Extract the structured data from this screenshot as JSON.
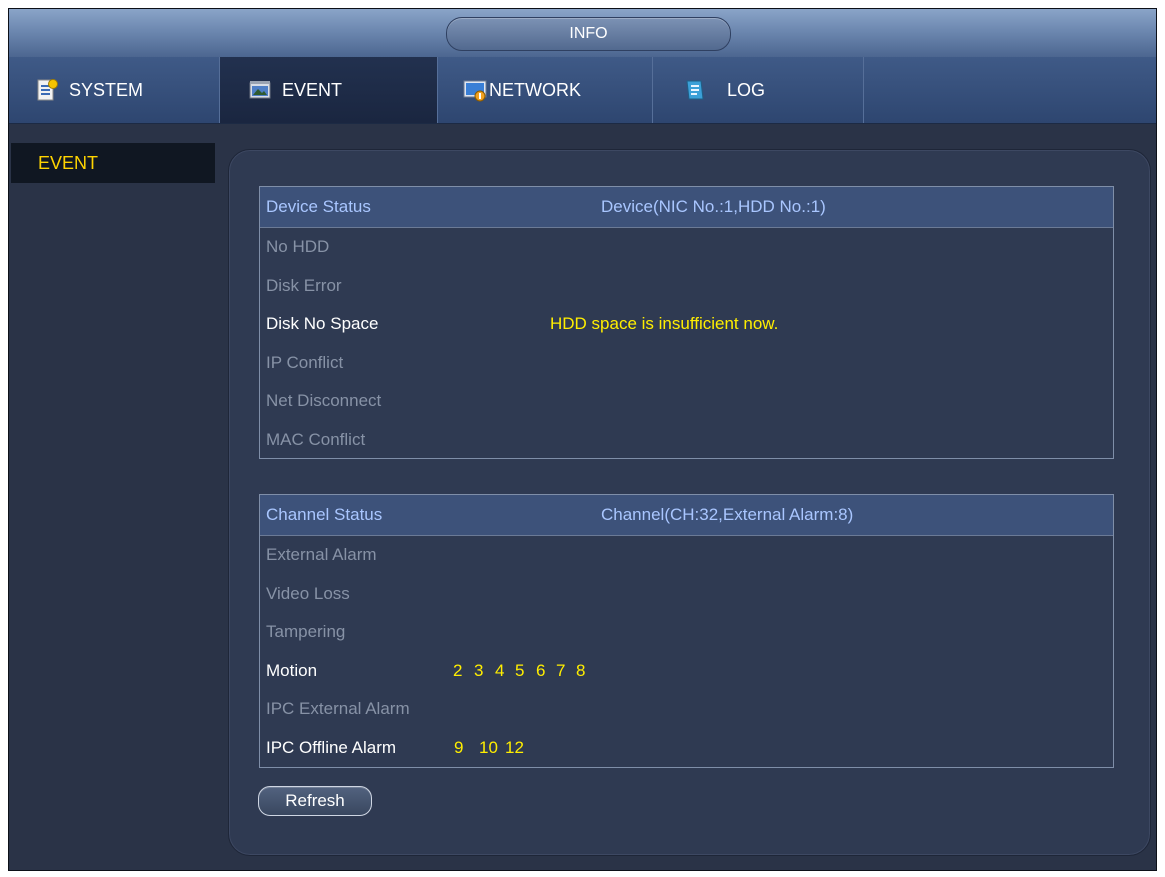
{
  "window": {
    "title": "INFO"
  },
  "tabs": [
    {
      "label": "SYSTEM",
      "icon": "system-icon"
    },
    {
      "label": "EVENT",
      "icon": "event-icon",
      "active": true
    },
    {
      "label": "NETWORK",
      "icon": "network-icon"
    },
    {
      "label": "LOG",
      "icon": "log-icon"
    }
  ],
  "sidebar": {
    "items": [
      {
        "label": "EVENT",
        "selected": true
      }
    ]
  },
  "device_status": {
    "header": "Device Status",
    "summary": "Device(NIC No.:1,HDD No.:1)",
    "rows": [
      {
        "label": "No HDD",
        "active": false,
        "value": ""
      },
      {
        "label": "Disk Error",
        "active": false,
        "value": ""
      },
      {
        "label": "Disk No Space",
        "active": true,
        "value": "HDD space is insufficient now."
      },
      {
        "label": "IP Conflict",
        "active": false,
        "value": ""
      },
      {
        "label": "Net Disconnect",
        "active": false,
        "value": ""
      },
      {
        "label": "MAC Conflict",
        "active": false,
        "value": ""
      }
    ]
  },
  "channel_status": {
    "header": "Channel Status",
    "summary": "Channel(CH:32,External Alarm:8)",
    "rows": [
      {
        "label": "External Alarm",
        "active": false,
        "channels": []
      },
      {
        "label": "Video Loss",
        "active": false,
        "channels": []
      },
      {
        "label": "Tampering",
        "active": false,
        "channels": []
      },
      {
        "label": "Motion",
        "active": true,
        "channels": [
          "2",
          "3",
          "4",
          "5",
          "6",
          "7",
          "8"
        ]
      },
      {
        "label": "IPC External Alarm",
        "active": false,
        "channels": []
      },
      {
        "label": "IPC Offline Alarm",
        "active": true,
        "channels": [
          "9",
          "10",
          "12"
        ]
      }
    ]
  },
  "buttons": {
    "refresh": "Refresh"
  },
  "colors": {
    "accent_yellow": "#ffee00",
    "selected_menu_text": "#ffd400",
    "inactive_text": "#8792a6",
    "header_text": "#a9c6ff",
    "panel_bg": "#2f3a52"
  }
}
